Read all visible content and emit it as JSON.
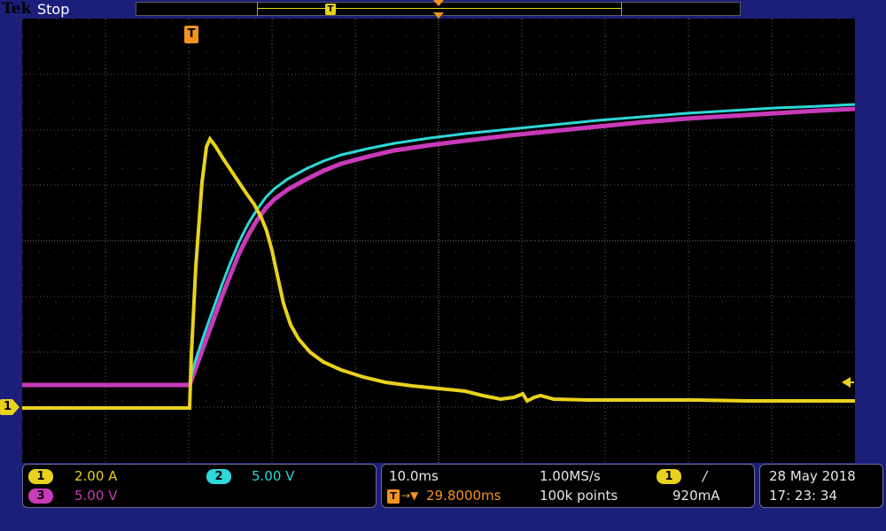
{
  "header": {
    "brand": "Tek",
    "acquisition_state": "Stop"
  },
  "colors": {
    "ch1": "#e8d21c",
    "ch2": "#2ed8d8",
    "ch3": "#c83ab8",
    "trigger": "#f29321",
    "background": "#1b1f7a"
  },
  "markers": {
    "trigger_label": "T",
    "ch1_ground_label": "1"
  },
  "channels": [
    {
      "badge": "1",
      "scale": "2.00 A"
    },
    {
      "badge": "2",
      "scale": "5.00 V"
    },
    {
      "badge": "3",
      "scale": "5.00 V"
    }
  ],
  "horizontal": {
    "time_per_div": "10.0ms",
    "sample_rate": "1.00MS/s",
    "trigger_position": "29.8000ms",
    "record_length": "100k points"
  },
  "trigger": {
    "source_badge": "1",
    "slope_symbol": "/",
    "level": "920mA"
  },
  "datetime": {
    "date": "28 May   2018",
    "time": "17: 23: 34"
  },
  "icons": {
    "trigger_marker": "trigger-t-icon",
    "trigger_level": "left-arrow-icon",
    "slope": "rising-edge-icon"
  }
}
